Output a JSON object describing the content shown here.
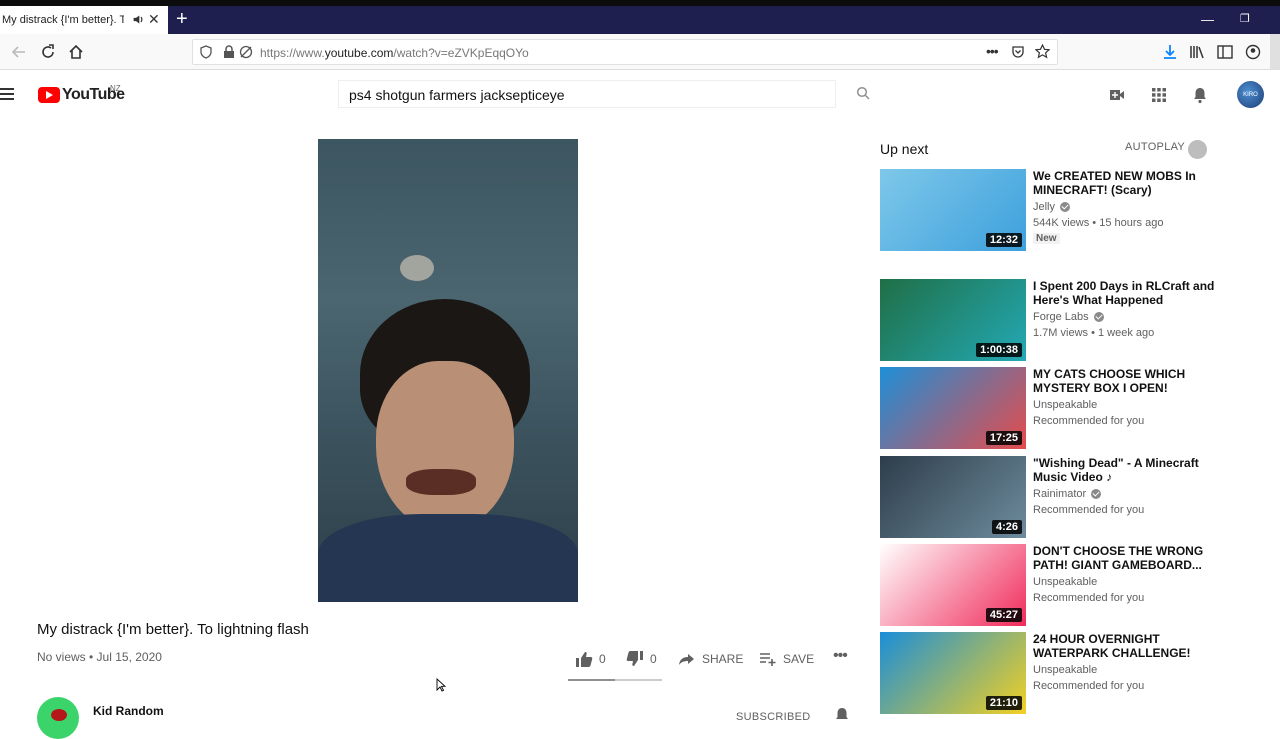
{
  "browser": {
    "tab_title": "My distrack {I'm better}. To",
    "url_prefix": "https://www.",
    "url_domain": "youtube.com",
    "url_path": "/watch?v=eZVKpEqqOYo"
  },
  "youtube": {
    "logo_text": "YouTube",
    "region": "NZ",
    "search_value": "ps4 shotgun farmers jacksepticeye",
    "avatar_text": "KIRO"
  },
  "video": {
    "title": "My distrack {I'm better}. To lightning flash",
    "meta": "No views • Jul 15, 2020",
    "likes": "0",
    "dislikes": "0",
    "share_label": "SHARE",
    "save_label": "SAVE",
    "sentiment_like_fraction": 0.5,
    "channel_name": "Kid Random",
    "subscribed_label": "SUBSCRIBED"
  },
  "sidebar": {
    "up_next_label": "Up next",
    "autoplay_label": "AUTOPLAY",
    "autoplay_on": false,
    "recommendations": [
      {
        "title": "We CREATED NEW MOBS In MINECRAFT! (Scary)",
        "channel": "Jelly",
        "verified": true,
        "meta": "544K views • 15 hours ago",
        "badge": "New",
        "duration": "12:32",
        "thumb_colors": [
          "#7ec8ea",
          "#3da0dc"
        ]
      },
      {
        "title": "I Spent 200 Days in RLCraft and Here's What Happened",
        "channel": "Forge Labs",
        "verified": true,
        "meta": "1.7M views • 1 week ago",
        "badge": "",
        "duration": "1:00:38",
        "thumb_colors": [
          "#1f6f46",
          "#24a9b5"
        ]
      },
      {
        "title": "MY CATS CHOOSE WHICH MYSTERY BOX I OPEN!",
        "channel": "Unspeakable",
        "verified": false,
        "meta": "Recommended for you",
        "badge": "",
        "duration": "17:25",
        "thumb_colors": [
          "#1d8fd8",
          "#e64b4b"
        ]
      },
      {
        "title": "\"Wishing Dead\" - A Minecraft Music Video ♪",
        "channel": "Rainimator",
        "verified": true,
        "meta": "Recommended for you",
        "badge": "",
        "duration": "4:26",
        "thumb_colors": [
          "#2e3d4a",
          "#6d8c9e"
        ]
      },
      {
        "title": "DON'T CHOOSE THE WRONG PATH! GIANT GAMEBOARD...",
        "channel": "Unspeakable",
        "verified": false,
        "meta": "Recommended for you",
        "badge": "",
        "duration": "45:27",
        "thumb_colors": [
          "#ffffff",
          "#f02a5a"
        ]
      },
      {
        "title": "24 HOUR OVERNIGHT WATERPARK CHALLENGE!",
        "channel": "Unspeakable",
        "verified": false,
        "meta": "Recommended for you",
        "badge": "",
        "duration": "21:10",
        "thumb_colors": [
          "#1a8ed8",
          "#f2d023"
        ]
      }
    ]
  }
}
